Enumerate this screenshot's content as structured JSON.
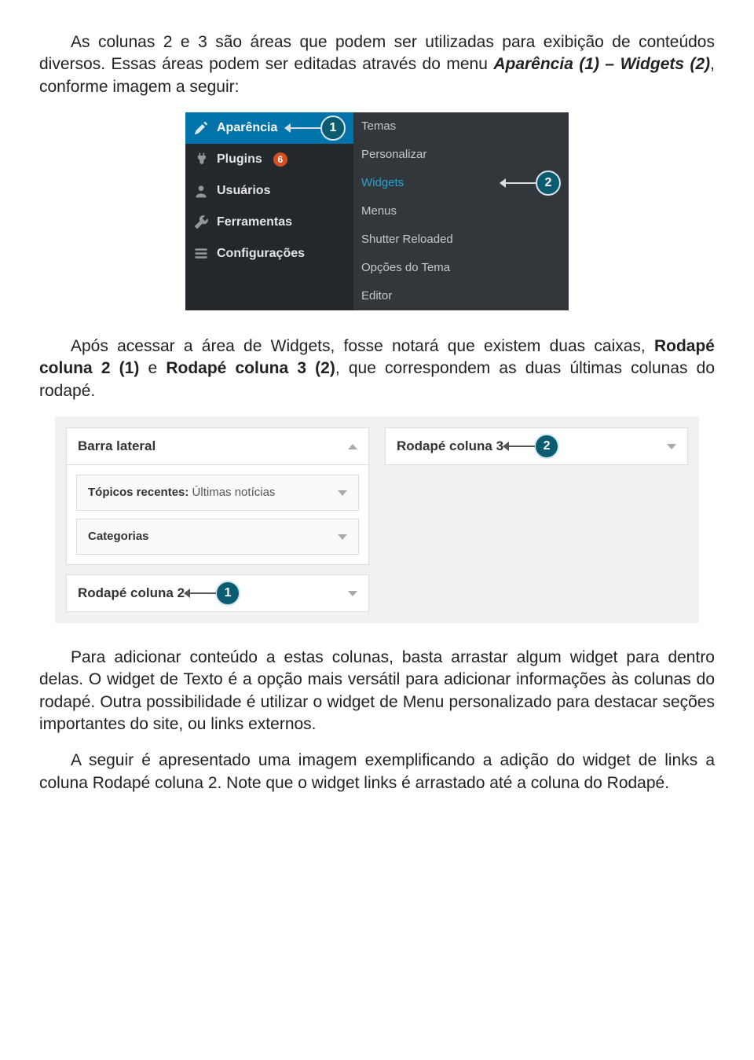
{
  "paragraphs": {
    "p1_a": "As colunas 2 e 3 são áreas que podem ser utilizadas para exibição de conteúdos diversos. Essas áreas podem ser editadas através do menu ",
    "p1_b": "Aparência (1) – Widgets (2)",
    "p1_c": ", conforme imagem a seguir:",
    "p2_a": "Após acessar a área de Widgets, fosse notará que existem duas caixas, ",
    "p2_b": "Rodapé coluna 2 (1)",
    "p2_c": " e ",
    "p2_d": "Rodapé coluna 3 (2)",
    "p2_e": ", que correspondem as duas últimas colunas do rodapé.",
    "p3": "Para adicionar conteúdo a estas colunas, basta arrastar algum widget para dentro delas. O widget de Texto é a opção mais versátil para adicionar informações às colunas do rodapé. Outra possibilidade é utilizar o widget de Menu personalizado para destacar seções importantes do site, ou links externos.",
    "p4": "A seguir é apresentado uma imagem exemplificando a adição do widget de links a coluna Rodapé coluna 2. Note que o widget links é arrastado até a coluna do Rodapé."
  },
  "shot1": {
    "left": {
      "aparencia": "Aparência",
      "plugins": "Plugins",
      "plugins_badge": "6",
      "usuarios": "Usuários",
      "ferramentas": "Ferramentas",
      "configuracoes": "Configurações"
    },
    "right": {
      "temas": "Temas",
      "personalizar": "Personalizar",
      "widgets": "Widgets",
      "menus": "Menus",
      "shutter": "Shutter Reloaded",
      "opcoes": "Opções do Tema",
      "editor": "Editor"
    },
    "callouts": {
      "c1": "1",
      "c2": "2"
    }
  },
  "shot2": {
    "barra_lateral": "Barra lateral",
    "topicos_label": "Tópicos recentes:",
    "topicos_value": "Últimas notícias",
    "categorias": "Categorias",
    "rodape2": "Rodapé coluna 2",
    "rodape3": "Rodapé coluna 3",
    "callouts": {
      "c1": "1",
      "c2": "2"
    }
  }
}
